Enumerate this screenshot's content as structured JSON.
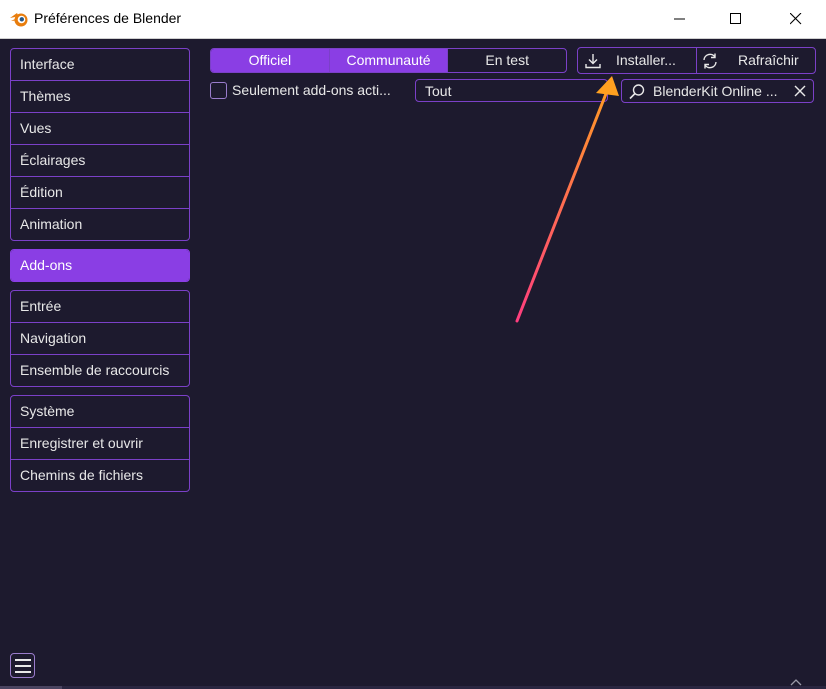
{
  "window": {
    "title": "Préférences de Blender",
    "app_icon": "blender-logo-icon"
  },
  "sidebar": {
    "groups": [
      {
        "items": [
          "Interface",
          "Thèmes",
          "Vues",
          "Éclairages",
          "Édition",
          "Animation"
        ]
      },
      {
        "items": [
          "Add-ons"
        ],
        "active": "Add-ons"
      },
      {
        "items": [
          "Entrée",
          "Navigation",
          "Ensemble de raccourcis"
        ]
      },
      {
        "items": [
          "Système",
          "Enregistrer et ouvrir",
          "Chemins de fichiers"
        ]
      }
    ]
  },
  "addons": {
    "tabs": [
      {
        "label": "Officiel",
        "active": true
      },
      {
        "label": "Communauté",
        "active": true
      },
      {
        "label": "En test",
        "active": false
      }
    ],
    "install_label": "Installer...",
    "refresh_label": "Rafraîchir",
    "only_enabled_label": "Seulement add-ons acti...",
    "only_enabled_checked": false,
    "category_value": "Tout",
    "search_value": "BlenderKit Online ..."
  },
  "colors": {
    "accent": "#8a3ee4",
    "border": "#7b40c8",
    "background": "#1d1a2e",
    "annotation_arrow_start": "#ff3d7f",
    "annotation_arrow_end": "#ffa020"
  }
}
